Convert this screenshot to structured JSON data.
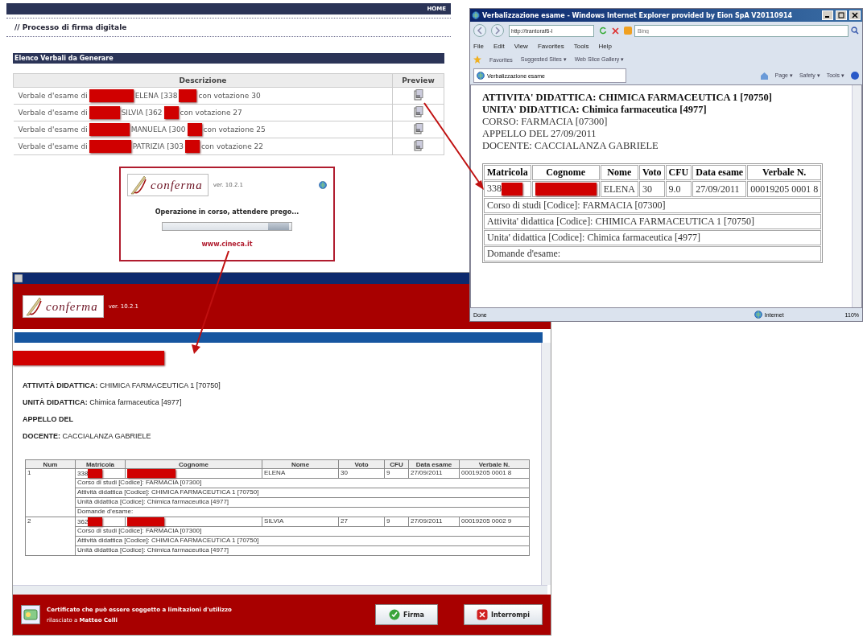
{
  "web_page": {
    "nav_link": "HOME",
    "heading": "// Processo di firma digitale",
    "section_title": "Elenco Verbali da Generare",
    "columns": [
      "Descrizione",
      "Preview"
    ],
    "rows": [
      {
        "prefix": "Verbale d'esame di",
        "name": "ELENA [338",
        "suffix": "con votazione 30"
      },
      {
        "prefix": "Verbale d'esame di",
        "name": "SILVIA [362",
        "suffix": "con votazione 27"
      },
      {
        "prefix": "Verbale d'esame di",
        "name": "MANUELA [300",
        "suffix": "con votazione 25"
      },
      {
        "prefix": "Verbale d'esame di",
        "name": "PATRIZIA [303",
        "suffix": "con votazione 22"
      }
    ]
  },
  "progress_dialog": {
    "logo": "conferma",
    "version": "ver. 10.2.1",
    "message": "Operazione in corso, attendere prego...",
    "level": 0.98,
    "link": "www.cineca.it"
  },
  "browser": {
    "title": "Verbalizzazione esame - Windows Internet Explorer provided by Eion SpA V20110914",
    "address": "http://trantoraf6-l",
    "search_placeholder": "Bing",
    "menu": [
      "File",
      "Edit",
      "View",
      "Favorites",
      "Tools",
      "Help"
    ],
    "favorites": [
      "Favorites",
      "Suggested Sites ▾",
      "Web Slice Gallery ▾"
    ],
    "tab": "Verbalizzazione esame",
    "commands": [
      "Page ▾",
      "Safety ▾",
      "Tools ▾"
    ],
    "document": {
      "lines": [
        {
          "text": "ATTIVITA' DIDATTICA: CHIMICA FARMACEUTICA 1 [70750]",
          "bold": true
        },
        {
          "text": "UNITA' DIDATTICA: Chimica farmaceutica [4977]",
          "bold": true
        },
        {
          "text": "CORSO: FARMACIA [07300]",
          "bold": false
        },
        {
          "text": "APPELLO DEL 27/09/2011",
          "bold": false
        },
        {
          "text": "DOCENTE: CACCIALANZA GABRIELE",
          "bold": false
        }
      ],
      "columns": [
        "Matricola",
        "Cognome",
        "Nome",
        "Voto",
        "CFU",
        "Data esame",
        "Verbale N."
      ],
      "row": {
        "matricola": "338",
        "nome": "ELENA",
        "voto": "30",
        "cfu": "9.0",
        "data": "27/09/2011",
        "verbale": "00019205 0001 8"
      },
      "details": [
        "Corso di studi [Codice]: FARMACIA [07300]",
        "Attivita' didattica [Codice]: CHIMICA FARMACEUTICA 1 [70750]",
        "Unita' didattica [Codice]: Chimica farmaceutica [4977]",
        "Domande d'esame:"
      ]
    },
    "status": "Done",
    "zone": "Internet",
    "zoom": "110%"
  },
  "signing_app": {
    "logo": "conferma",
    "version": "ver. 10.2.1",
    "info": [
      {
        "label": "ATTIVITÀ DIDATTICA:",
        "value": "CHIMICA FARMACEUTICA 1 [70750]"
      },
      {
        "label": "UNITÀ DIDATTICA:",
        "value": "Chimica farmaceutica [4977]"
      },
      {
        "label": "APPELLO DEL"
      },
      {
        "label": "DOCENTE:",
        "value": "CACCIALANZA GABRIELE"
      }
    ],
    "columns": [
      "Num",
      "Matricola",
      "Cognome",
      "Nome",
      "Voto",
      "CFU",
      "Data esame",
      "Verbale N."
    ],
    "rows": [
      {
        "num": "1",
        "matricola": "338",
        "nome": "ELENA",
        "voto": "30",
        "cfu": "9",
        "data": "27/09/2011",
        "verbale": "00019205 0001 8",
        "details": [
          "Corso di studi [Codice]: FARMACIA [07300]",
          "Attività didattica [Codice]: CHIMICA FARMACEUTICA 1 [70750]",
          "Unità didattica [Codice]: Chimica farmaceutica [4977]",
          "Domande d'esame:"
        ]
      },
      {
        "num": "2",
        "matricola": "362",
        "nome": "SILVIA",
        "voto": "27",
        "cfu": "9",
        "data": "27/09/2011",
        "verbale": "00019205 0002 9",
        "details": [
          "Corso di studi [Codice]: FARMACIA [07300]",
          "Attività didattica [Codice]: CHIMICA FARMACEUTICA 1 [70750]",
          "Unità didattica [Codice]: Chimica farmaceutica [4977]"
        ]
      }
    ],
    "certificate": "Certificato che può essere soggetto a limitazioni d'utilizzo",
    "issued_to": "rilasciato a **Matteo Celli**",
    "buttons": [
      {
        "kind": "confirm",
        "label": "Firma"
      },
      {
        "kind": "stop",
        "label": "Interrompi"
      }
    ]
  }
}
